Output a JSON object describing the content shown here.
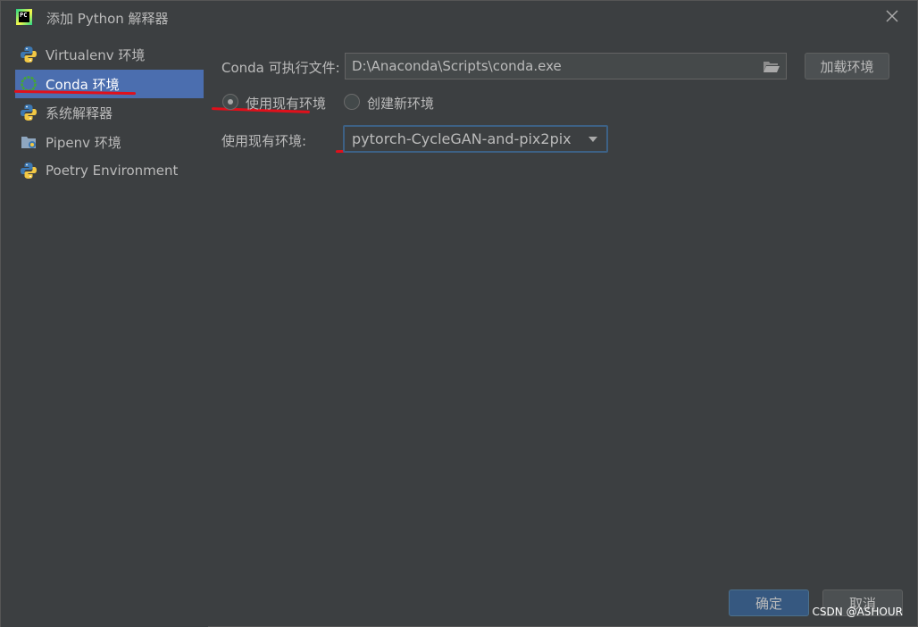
{
  "window": {
    "title": "添加 Python 解释器"
  },
  "sidebar": {
    "items": [
      {
        "label": "Virtualenv 环境",
        "icon": "python-icon"
      },
      {
        "label": "Conda 环境",
        "icon": "conda-icon",
        "selected": true
      },
      {
        "label": "系统解释器",
        "icon": "python-icon"
      },
      {
        "label": "Pipenv 环境",
        "icon": "pipenv-icon"
      },
      {
        "label": "Poetry Environment",
        "icon": "python-icon"
      }
    ]
  },
  "conda": {
    "exe_label": "Conda 可执行文件:",
    "exe_value": "D:\\Anaconda\\Scripts\\conda.exe",
    "load_env_button": "加载环境",
    "radio_existing": "使用现有环境",
    "radio_new": "创建新环境",
    "existing_env_label": "使用现有环境:",
    "existing_env_value": "pytorch-CycleGAN-and-pix2pix"
  },
  "footer": {
    "ok_button": "确定",
    "cancel_button": "取消"
  },
  "watermark": "CSDN @ASHOUR",
  "colors": {
    "background": "#3c3f41",
    "selection": "#4b6eaf",
    "primary_button": "#365880",
    "annotation_red": "#e0101b"
  }
}
